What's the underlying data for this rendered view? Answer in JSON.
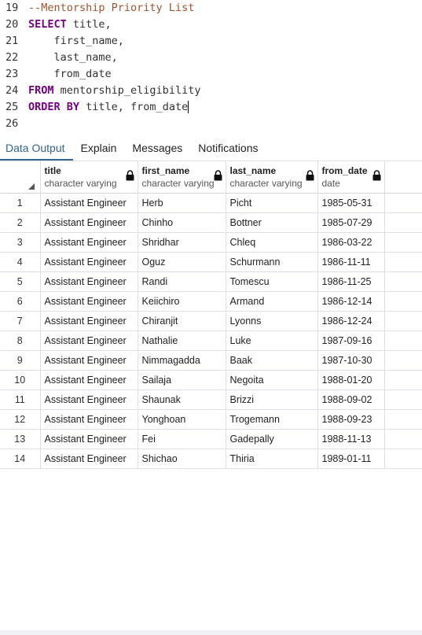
{
  "editor": {
    "lines": [
      {
        "num": "19",
        "parts": [
          {
            "t": "comment",
            "v": "--Mentorship Priority List"
          }
        ]
      },
      {
        "num": "20",
        "parts": [
          {
            "t": "kw",
            "v": "SELECT"
          },
          {
            "t": "id",
            "v": " title,"
          }
        ]
      },
      {
        "num": "21",
        "parts": [
          {
            "t": "id",
            "v": "    first_name,"
          }
        ]
      },
      {
        "num": "22",
        "parts": [
          {
            "t": "id",
            "v": "    last_name,"
          }
        ]
      },
      {
        "num": "23",
        "parts": [
          {
            "t": "id",
            "v": "    from_date"
          }
        ]
      },
      {
        "num": "24",
        "parts": [
          {
            "t": "kw",
            "v": "FROM"
          },
          {
            "t": "id",
            "v": " mentorship_eligibility"
          }
        ]
      },
      {
        "num": "25",
        "parts": [
          {
            "t": "kw",
            "v": "ORDER BY"
          },
          {
            "t": "id",
            "v": " title, from_date"
          }
        ],
        "cursor": true
      },
      {
        "num": "26",
        "parts": []
      }
    ]
  },
  "tabs": [
    {
      "label": "Data Output",
      "active": true
    },
    {
      "label": "Explain",
      "active": false
    },
    {
      "label": "Messages",
      "active": false
    },
    {
      "label": "Notifications",
      "active": false
    }
  ],
  "grid": {
    "columns": [
      {
        "name": "title",
        "type": "character varying"
      },
      {
        "name": "first_name",
        "type": "character varying"
      },
      {
        "name": "last_name",
        "type": "character varying"
      },
      {
        "name": "from_date",
        "type": "date"
      }
    ],
    "rows": [
      [
        "1",
        "Assistant Engineer",
        "Herb",
        "Picht",
        "1985-05-31"
      ],
      [
        "2",
        "Assistant Engineer",
        "Chinho",
        "Bottner",
        "1985-07-29"
      ],
      [
        "3",
        "Assistant Engineer",
        "Shridhar",
        "Chleq",
        "1986-03-22"
      ],
      [
        "4",
        "Assistant Engineer",
        "Oguz",
        "Schurmann",
        "1986-11-11"
      ],
      [
        "5",
        "Assistant Engineer",
        "Randi",
        "Tomescu",
        "1986-11-25"
      ],
      [
        "6",
        "Assistant Engineer",
        "Keiichiro",
        "Armand",
        "1986-12-14"
      ],
      [
        "7",
        "Assistant Engineer",
        "Chiranjit",
        "Lyonns",
        "1986-12-24"
      ],
      [
        "8",
        "Assistant Engineer",
        "Nathalie",
        "Luke",
        "1987-09-16"
      ],
      [
        "9",
        "Assistant Engineer",
        "Nimmagadda",
        "Baak",
        "1987-10-30"
      ],
      [
        "10",
        "Assistant Engineer",
        "Sailaja",
        "Negoita",
        "1988-01-20"
      ],
      [
        "11",
        "Assistant Engineer",
        "Shaunak",
        "Brizzi",
        "1988-09-02"
      ],
      [
        "12",
        "Assistant Engineer",
        "Yonghoan",
        "Trogemann",
        "1988-09-23"
      ],
      [
        "13",
        "Assistant Engineer",
        "Fei",
        "Gadepally",
        "1988-11-13"
      ],
      [
        "14",
        "Assistant Engineer",
        "Shichao",
        "Thiria",
        "1989-01-11"
      ]
    ]
  },
  "colors": {
    "accent": "#326690",
    "keyword": "#770088",
    "comment": "#a0522d",
    "grid_border": "#dde0e6"
  }
}
